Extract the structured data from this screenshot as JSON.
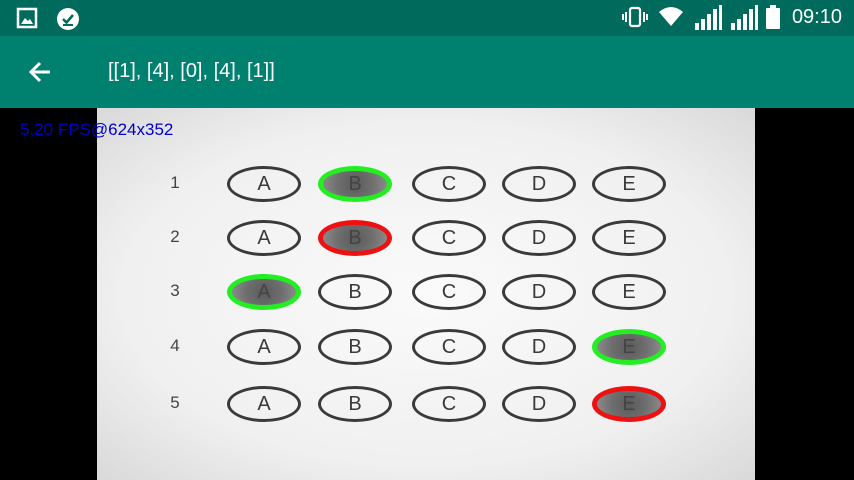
{
  "status_bar": {
    "left_icons": [
      "image-icon",
      "download-done-icon"
    ],
    "right_icons": [
      "vibrate-icon",
      "wifi-icon",
      "signal-icon",
      "signal-icon-2",
      "battery-icon"
    ],
    "time": "09:10"
  },
  "app_bar": {
    "title": "[[1], [4], [0], [4], [1]]",
    "back_icon": "arrow-back-icon"
  },
  "camera": {
    "fps_text": "5,20 FPS@624x352",
    "questions": [
      {
        "number": "1",
        "options": [
          "A",
          "B",
          "C",
          "D",
          "E"
        ],
        "marked": "B",
        "status": "correct"
      },
      {
        "number": "2",
        "options": [
          "A",
          "B",
          "C",
          "D",
          "E"
        ],
        "marked": "B",
        "status": "wrong"
      },
      {
        "number": "3",
        "options": [
          "A",
          "B",
          "C",
          "D",
          "E"
        ],
        "marked": "A",
        "status": "correct"
      },
      {
        "number": "4",
        "options": [
          "A",
          "B",
          "C",
          "D",
          "E"
        ],
        "marked": "E",
        "status": "correct"
      },
      {
        "number": "5",
        "options": [
          "A",
          "B",
          "C",
          "D",
          "E"
        ],
        "marked": "E",
        "status": "wrong"
      }
    ]
  },
  "colors": {
    "status_bar": "#006a5c",
    "app_bar": "#00806e",
    "correct": "#22ee22",
    "wrong": "#ee1111",
    "fps_text": "#0000cc"
  }
}
